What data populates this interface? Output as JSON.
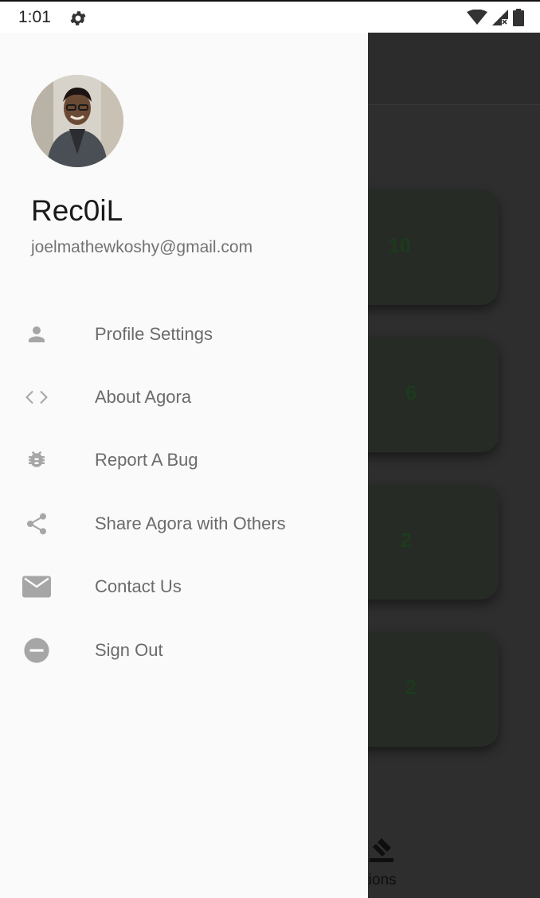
{
  "status_bar": {
    "time": "1:01",
    "icons": [
      "gear-icon",
      "wifi-icon",
      "signal-icon",
      "battery-icon"
    ]
  },
  "drawer": {
    "user_name": "Rec0iL",
    "user_email": "joelmathewkoshy@gmail.com",
    "menu": [
      {
        "label": "Profile Settings",
        "icon": "person-icon"
      },
      {
        "label": "About Agora",
        "icon": "code-icon"
      },
      {
        "label": "Report A Bug",
        "icon": "bug-icon"
      },
      {
        "label": "Share Agora with Others",
        "icon": "share-icon"
      },
      {
        "label": "Contact Us",
        "icon": "mail-icon"
      },
      {
        "label": "Sign Out",
        "icon": "sign-out-icon"
      }
    ]
  },
  "background": {
    "cards": [
      {
        "value": "10"
      },
      {
        "value": "6"
      },
      {
        "value": "2"
      },
      {
        "value": "2"
      }
    ],
    "bottom_nav_label": "ctions"
  },
  "colors": {
    "drawer_bg": "#fafafa",
    "scrim": "#2e2e2e",
    "icon": "#a6a6a6",
    "label": "#6b6b6b"
  }
}
